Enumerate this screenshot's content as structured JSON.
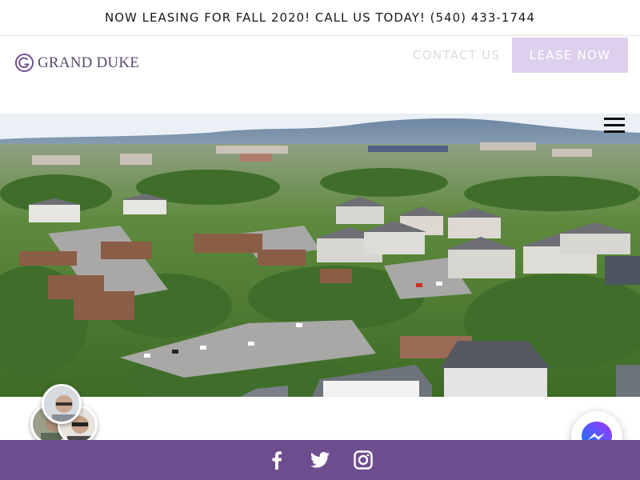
{
  "announcement": {
    "text": "NOW LEASING FOR FALL 2020! CALL US TODAY! (540) 433-1744"
  },
  "brand": {
    "name": "GRAND DUKE",
    "primary_color": "#6e4d8f",
    "accent_color": "#ddd0ec"
  },
  "nav": {
    "contact_label": "CONTACT US",
    "lease_label": "LEASE NOW"
  },
  "hero": {
    "icon": "aerial-campus-photo"
  },
  "menu": {
    "icon": "hamburger-icon"
  },
  "chat": {
    "agents_icon": "agent-avatars",
    "messenger_icon": "messenger-icon"
  },
  "footer": {
    "social": [
      "facebook-icon",
      "twitter-icon",
      "instagram-icon"
    ]
  }
}
